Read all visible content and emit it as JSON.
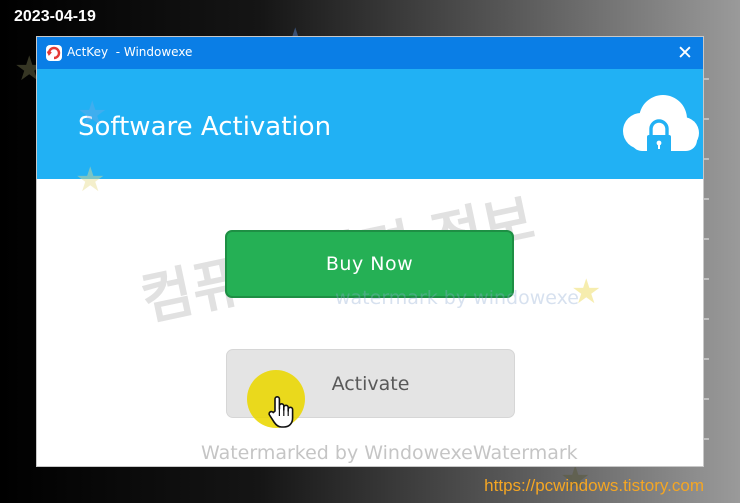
{
  "overlay": {
    "date": "2023-04-19",
    "url": "https://pcwindows.tistory.com"
  },
  "dialog": {
    "app_name": "ActKey",
    "window_title": "  - Windowexe",
    "close_glyph": "✕",
    "header_title": "Software Activation",
    "header_icon": "cloud-lock-icon",
    "buy_label": "Buy Now",
    "activate_label": "Activate"
  },
  "watermarks": {
    "korean": "컴퓨터 관련 정보",
    "center": "watermark by windowexe",
    "bottom": "Watermarked by WindowexeWatermark"
  },
  "colors": {
    "titlebar": "#0a7ee6",
    "header": "#21b1f4",
    "buy_button": "#25b055",
    "activate_button": "#e4e4e4",
    "url_text": "#f5a623"
  }
}
